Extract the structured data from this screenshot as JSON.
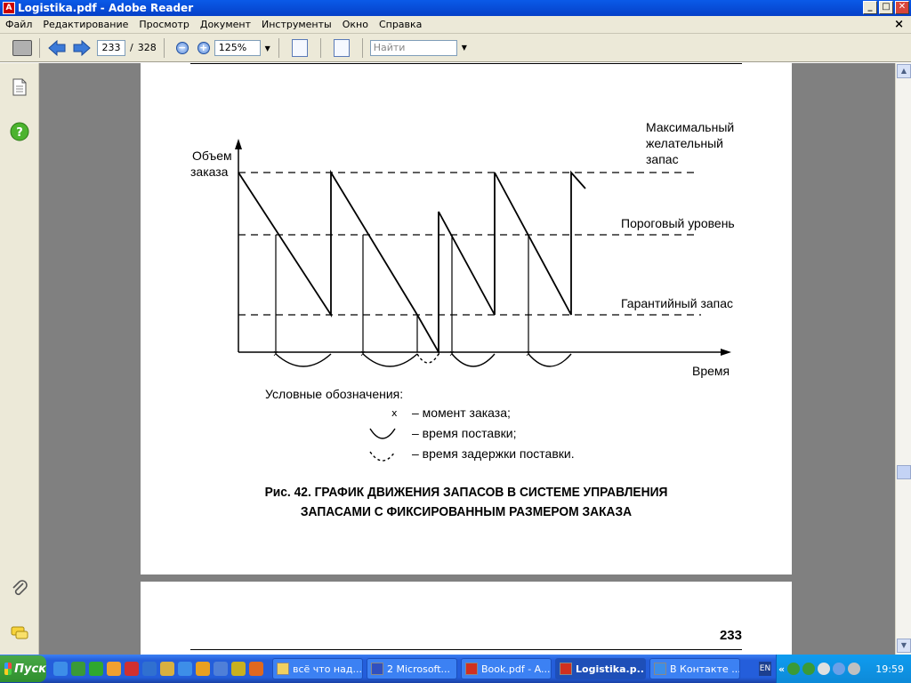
{
  "window": {
    "title": "Logistika.pdf - Adobe Reader",
    "app_icon_glyph": "A",
    "minimize": "_",
    "maximize": "□",
    "close": "✕"
  },
  "menu": {
    "items": [
      "Файл",
      "Редактирование",
      "Просмотр",
      "Документ",
      "Инструменты",
      "Окно",
      "Справка"
    ],
    "doc_close": "×"
  },
  "toolbar": {
    "current_page": "233",
    "page_separator": "/",
    "total_pages": "328",
    "zoom_out": "−",
    "zoom_in": "+",
    "zoom_value": "125%",
    "find_placeholder": "Найти"
  },
  "document": {
    "page2_number": "233",
    "caption_line1": "Рис. 42. ГРАФИК ДВИЖЕНИЯ ЗАПАСОВ В СИСТЕМЕ УПРАВЛЕНИЯ",
    "caption_line2": "ЗАПАСАМИ С ФИКСИРОВАННЫМ РАЗМЕРОМ ЗАКАЗА"
  },
  "chart_data": {
    "type": "line",
    "ylabel_line1": "Объем",
    "ylabel_line2": "заказа",
    "xlabel": "Время",
    "levels": [
      {
        "label_lines": [
          "Максимальный",
          "желательный",
          "запас"
        ]
      },
      {
        "label_lines": [
          "Пороговый уровень"
        ]
      },
      {
        "label_lines": [
          "Гарантийный запас"
        ]
      }
    ],
    "legend_title": "Условные обозначения:",
    "legend": [
      {
        "symbol": "x",
        "label": "– момент заказа;"
      },
      {
        "symbol": "solid-arc",
        "label": "– время поставки;"
      },
      {
        "symbol": "dashed-arc",
        "label": "– время задержки поставки."
      }
    ]
  },
  "taskbar": {
    "start_label": "Пуск",
    "tasks": [
      "всё что над...",
      "2 Microsoft...",
      "Book.pdf - A...",
      "Logistika.p...",
      "В Контакте ..."
    ],
    "lang": "EN",
    "tray_chevron": "«",
    "clock": "19:59"
  },
  "colors": {
    "title_bar": "#0a5ae8",
    "chrome": "#ece9d8",
    "doc_background": "#808080",
    "taskbar": "#245edb",
    "start_button": "#3a9a38"
  }
}
